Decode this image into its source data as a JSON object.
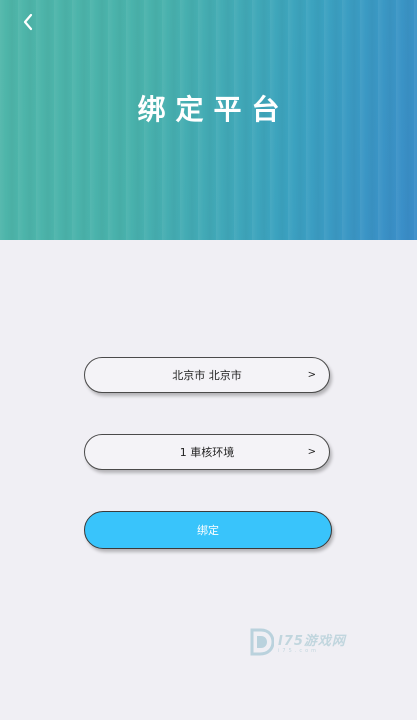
{
  "header": {
    "title": "绑定平台",
    "back_icon": "chevron-left-icon"
  },
  "form": {
    "region": {
      "value": "北京市 北京市",
      "chevron": ">"
    },
    "company": {
      "value": "1 車核环境",
      "chevron": ">"
    },
    "bind_button": {
      "label": "绑定"
    }
  },
  "watermark": {
    "text": "I75游戏网",
    "sub": "i75.com"
  },
  "colors": {
    "header_gradient_start": "#4fb6a9",
    "header_gradient_end": "#3a8cc9",
    "background": "#f0eff4",
    "primary_button": "#39c4fb"
  }
}
